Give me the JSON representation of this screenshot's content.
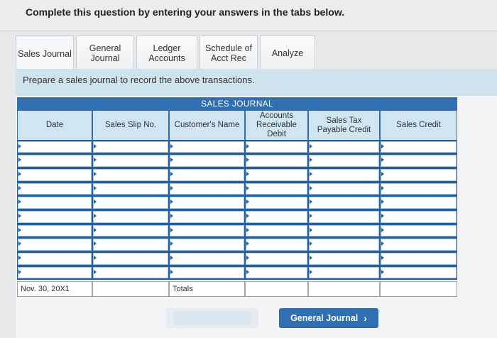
{
  "instructions": "Complete this question by entering your answers in the tabs below.",
  "tabs": [
    {
      "label": "Sales Journal",
      "active": true
    },
    {
      "label": "General\nJournal",
      "active": false
    },
    {
      "label": "Ledger\nAccounts",
      "active": false
    },
    {
      "label": "Schedule of\nAcct Rec",
      "active": false
    },
    {
      "label": "Analyze",
      "active": false
    }
  ],
  "prompt": "Prepare a sales journal to record the above transactions.",
  "journal": {
    "title": "SALES JOURNAL",
    "columns": [
      "Date",
      "Sales Slip No.",
      "Customer's Name",
      "Accounts\nReceivable\nDebit",
      "Sales Tax\nPayable Credit",
      "Sales Credit"
    ],
    "footer": {
      "date": "Nov. 30, 20X1",
      "totals_label": "Totals"
    }
  },
  "buttons": {
    "next_label": "General Journal",
    "next_icon": "chevron-right-icon"
  },
  "colors": {
    "accent": "#2f6fb2",
    "header_fill": "#cfe5f2",
    "instruction_panel": "#cfe3ee"
  }
}
